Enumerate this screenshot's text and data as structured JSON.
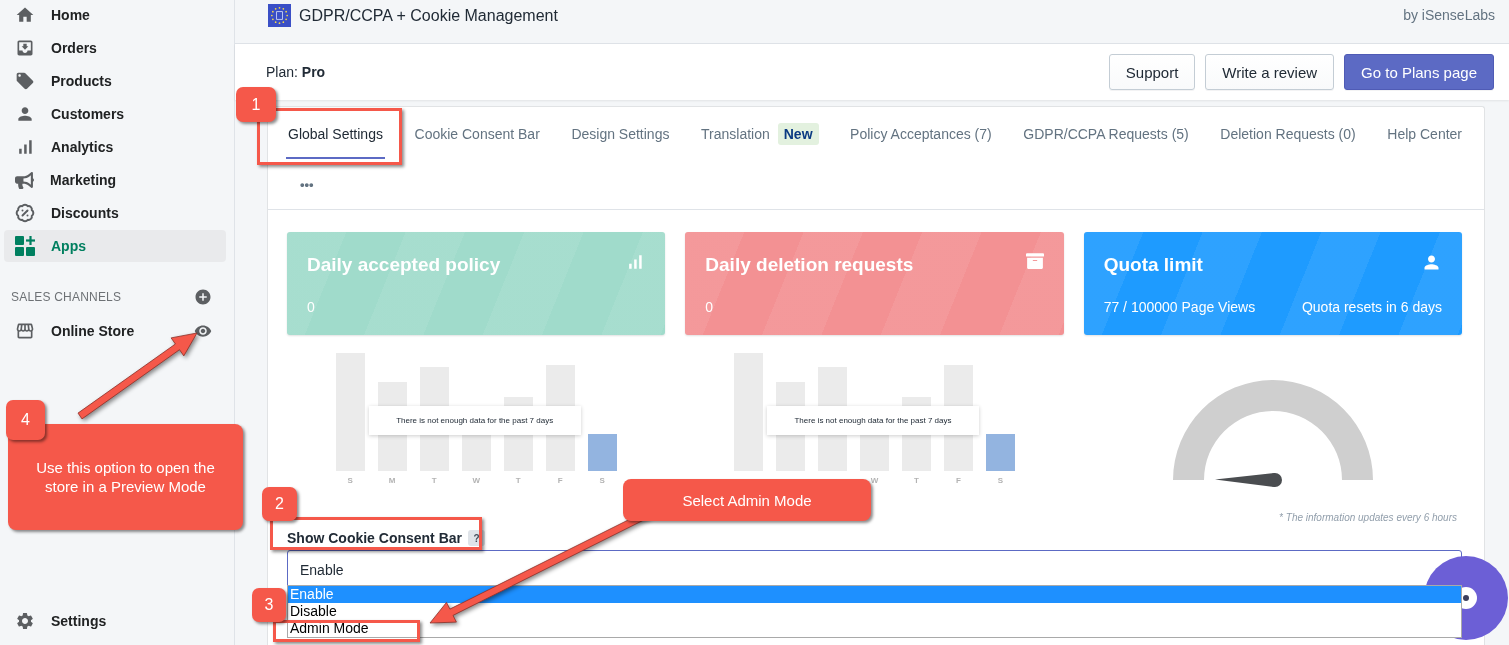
{
  "sidebar": {
    "items": [
      {
        "label": "Home",
        "selected": false
      },
      {
        "label": "Orders",
        "selected": false
      },
      {
        "label": "Products",
        "selected": false
      },
      {
        "label": "Customers",
        "selected": false
      },
      {
        "label": "Analytics",
        "selected": false
      },
      {
        "label": "Marketing",
        "selected": false
      },
      {
        "label": "Discounts",
        "selected": false
      },
      {
        "label": "Apps",
        "selected": true
      }
    ],
    "sales_channels": {
      "heading": "SALES CHANNELS",
      "items": [
        {
          "label": "Online Store"
        }
      ]
    },
    "footer_item": {
      "label": "Settings"
    }
  },
  "header": {
    "app_title": "GDPR/CCPA + Cookie Management",
    "vendor": "by iSenseLabs"
  },
  "plan": "Plan: **Pro**",
  "buttons": [
    {
      "label": "Support",
      "kind": "secondary"
    },
    {
      "label": "Write a review",
      "kind": "secondary"
    },
    {
      "label": "Go to Plans page",
      "kind": "primary"
    }
  ],
  "tabs": [
    {
      "label": "Global Settings",
      "selected": true
    },
    {
      "label": "Cookie Consent Bar",
      "selected": false
    },
    {
      "label": "Design Settings",
      "selected": false
    },
    {
      "label": "Translation",
      "badge": "New",
      "selected": false
    },
    {
      "label": "Policy Acceptances (7)",
      "selected": false
    },
    {
      "label": "GDPR/CCPA Requests (5)",
      "selected": false
    },
    {
      "label": "Deletion Requests (0)",
      "selected": false
    },
    {
      "label": "Help Center",
      "selected": false
    }
  ],
  "more_tabs": "•••",
  "stat_cards": [
    {
      "title": "Daily accepted policy",
      "value": "0",
      "color": "#a0dbcb"
    },
    {
      "title": "Daily deletion requests",
      "value": "0",
      "color": "#f39193"
    },
    {
      "title": "Quota limit",
      "value": "77 / 100000 Page Views",
      "note": "Quota resets in 6 days",
      "color": "#1e9bff"
    }
  ],
  "charts": [
    {
      "day_labels": [
        "S",
        "M",
        "T",
        "W",
        "T",
        "F",
        "S"
      ],
      "message": "There is not enough data for the past 7 days"
    },
    {
      "day_labels": [
        "W",
        "T",
        "F",
        "S"
      ],
      "message": "There is not enough data for the past 7 days"
    }
  ],
  "footnote": "* The information updates every 6 hours",
  "consent_field": {
    "label": "Show Cookie Consent Bar",
    "help": "?",
    "value": "Enable",
    "expanded": true,
    "options": [
      {
        "label": "Enable",
        "selected": true
      },
      {
        "label": "Disable",
        "selected": false
      },
      {
        "label": "Admin Mode",
        "selected": false
      }
    ]
  },
  "annotations": {
    "steps": [
      "1",
      "2",
      "3",
      "4"
    ],
    "notes": [
      "Use this option to open the store in a Preview Mode",
      "Select Admin Mode"
    ]
  }
}
